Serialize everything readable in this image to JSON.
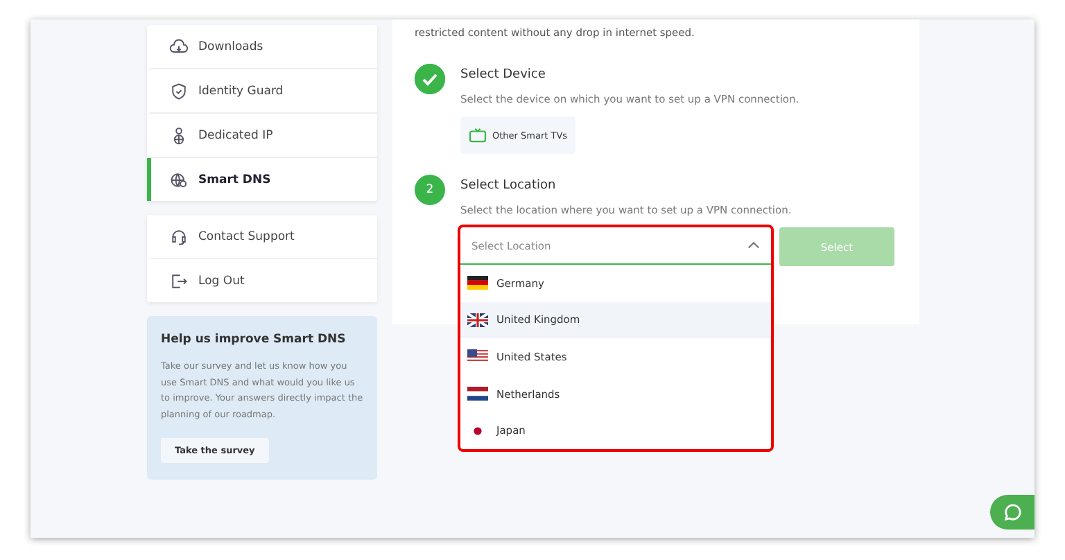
{
  "sidebar": {
    "groups": [
      {
        "items": [
          {
            "label": "Downloads",
            "selected": false
          },
          {
            "label": "Identity Guard",
            "selected": false
          },
          {
            "label": "Dedicated IP",
            "selected": false
          },
          {
            "label": "Smart DNS",
            "selected": true
          }
        ]
      },
      {
        "items": [
          {
            "label": "Contact Support",
            "selected": false
          },
          {
            "label": "Log Out",
            "selected": false
          }
        ]
      }
    ],
    "survey": {
      "title": "Help us improve Smart DNS",
      "text": "Take our survey and let us know how you use Smart DNS and what would you like us to improve. Your answers directly impact the planning of our roadmap.",
      "button": "Take the survey"
    }
  },
  "main": {
    "intro": "restricted content without any drop in internet speed.",
    "steps": [
      {
        "done": true,
        "title": "Select Device",
        "description": "Select the device on which you want to set up a VPN connection.",
        "chip": "Other Smart TVs"
      },
      {
        "done": false,
        "number": "2",
        "title": "Select Location",
        "description": "Select the location where you want to set up a VPN connection."
      }
    ],
    "location_select": {
      "placeholder": "Select Location",
      "expanded": true,
      "options": [
        {
          "label": "Germany",
          "highlighted": false
        },
        {
          "label": "United Kingdom",
          "highlighted": true
        },
        {
          "label": "United States",
          "highlighted": false
        },
        {
          "label": "Netherlands",
          "highlighted": false
        },
        {
          "label": "Japan",
          "highlighted": false
        }
      ]
    },
    "select_button": {
      "label": "Select",
      "disabled": true
    }
  }
}
